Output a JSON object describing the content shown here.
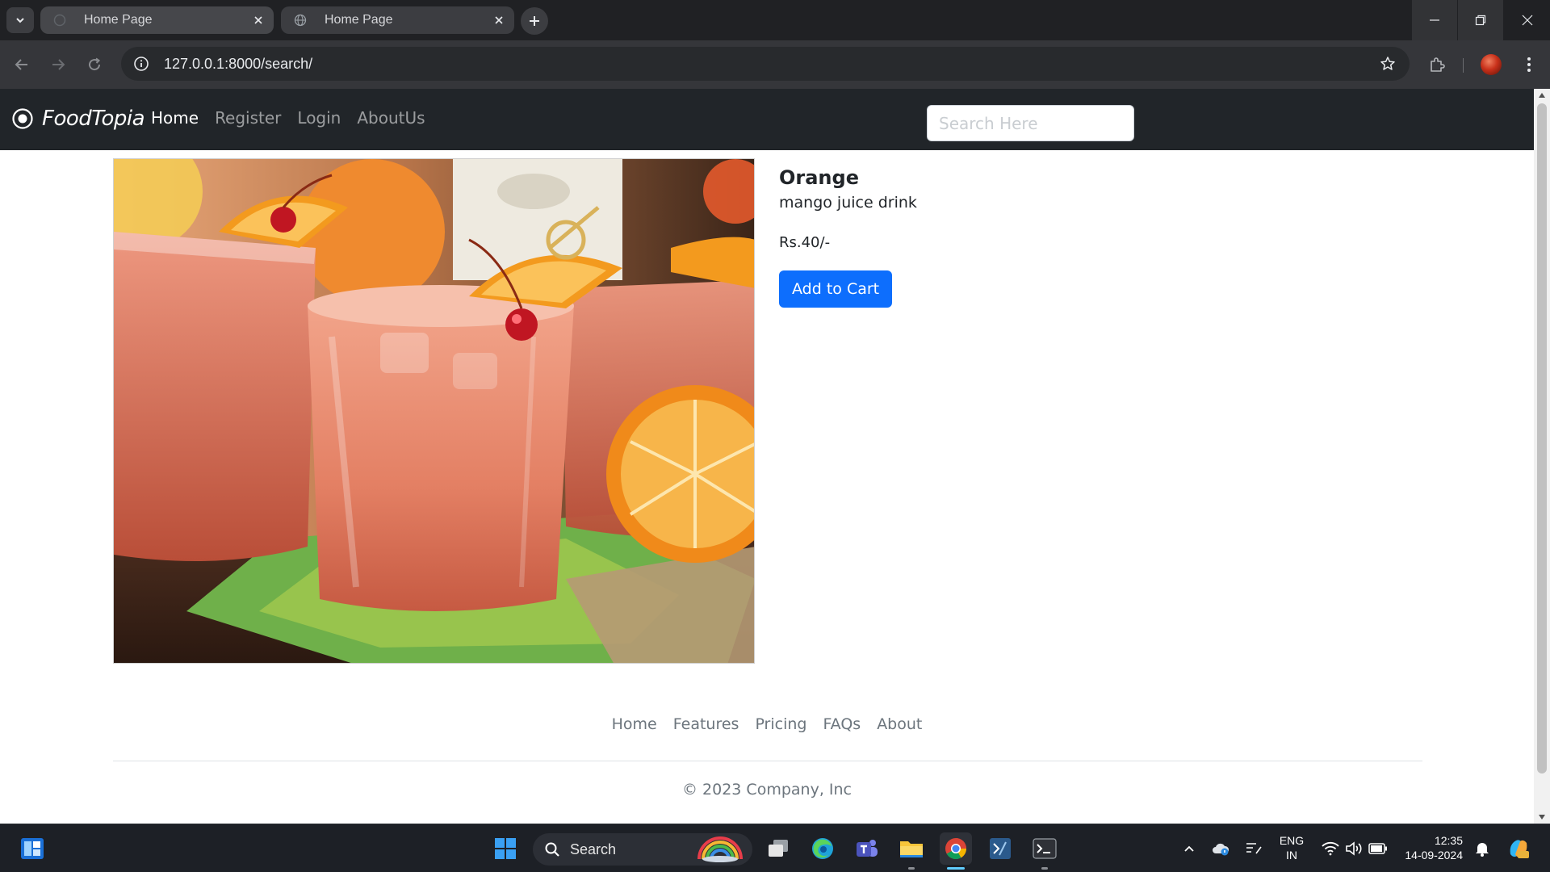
{
  "browser": {
    "tabs": [
      {
        "title": "Home Page",
        "active": false
      },
      {
        "title": "Home Page",
        "active": true
      }
    ],
    "url": "127.0.0.1:8000/search/"
  },
  "site": {
    "brand": "FoodTopia",
    "nav": [
      {
        "label": "Home",
        "active": true
      },
      {
        "label": "Register",
        "active": false
      },
      {
        "label": "Login",
        "active": false
      },
      {
        "label": "AboutUs",
        "active": false
      }
    ],
    "search_placeholder": "Search Here"
  },
  "product": {
    "image_icon": "juice-drink-photo",
    "name": "Orange",
    "description": "mango juice drink",
    "price": "Rs.40/-",
    "cta_label": "Add to Cart"
  },
  "footer": {
    "links": [
      "Home",
      "Features",
      "Pricing",
      "FAQs",
      "About"
    ],
    "copyright": "© 2023 Company, Inc"
  },
  "taskbar": {
    "search_label": "Search",
    "language_top": "ENG",
    "language_bottom": "IN",
    "time": "12:35",
    "date": "14-09-2024"
  },
  "colors": {
    "navbar_bg": "#212529",
    "primary_button": "#0d6efd",
    "browser_chrome": "#202124"
  }
}
